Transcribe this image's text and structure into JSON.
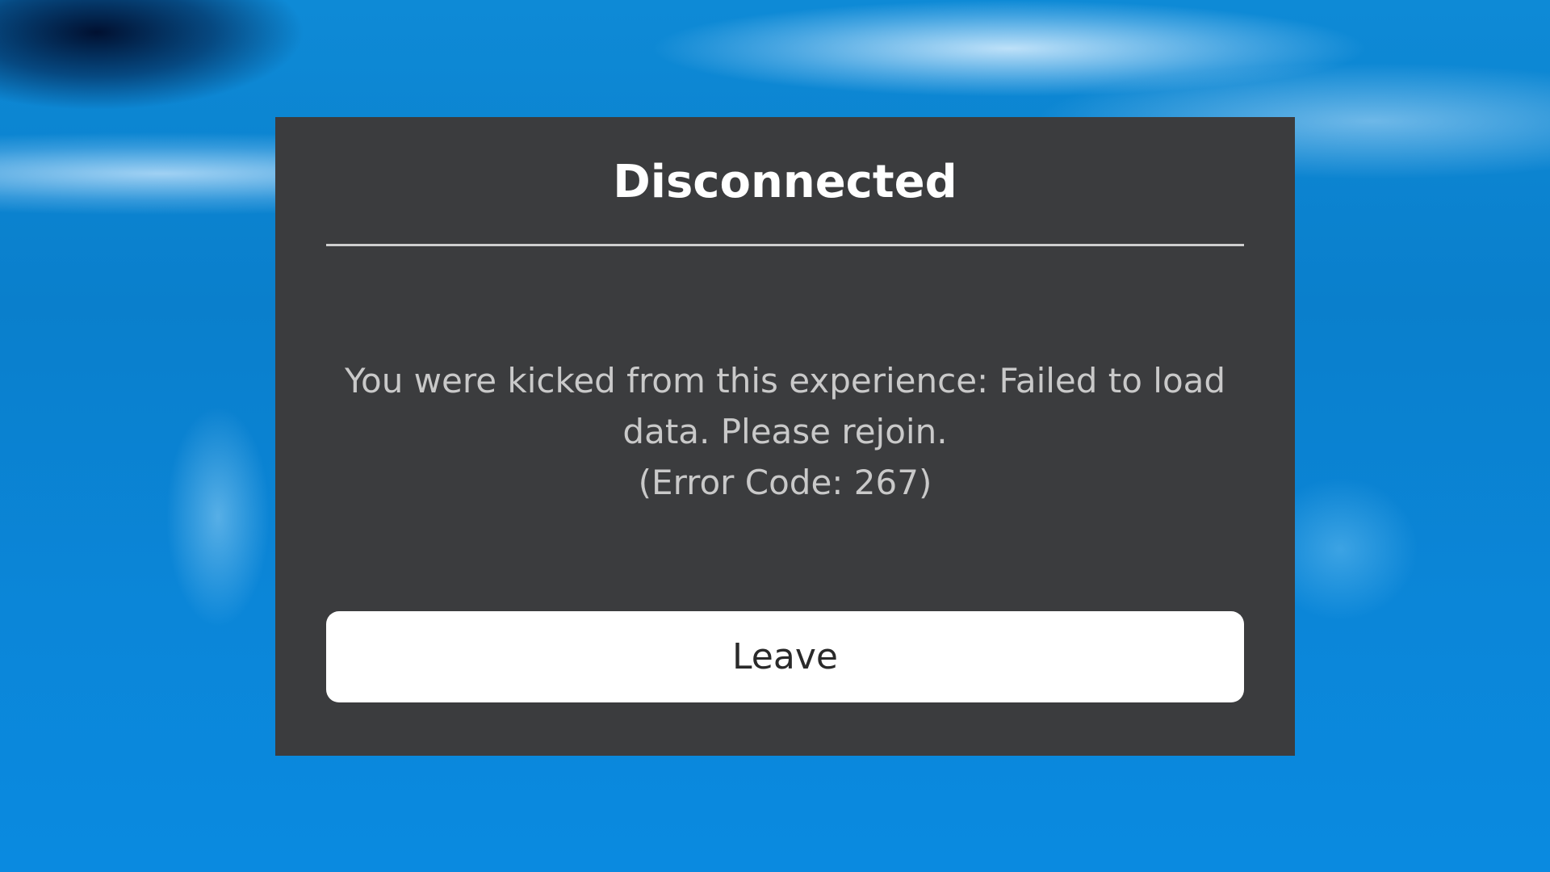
{
  "dialog": {
    "title": "Disconnected",
    "message": "You were kicked from this experience: Failed to load data. Please rejoin.",
    "error_code": "(Error Code: 267)",
    "leave_label": "Leave"
  },
  "colors": {
    "background": "#0a86d6",
    "dialog_background": "#3b3c3e",
    "title_text": "#ffffff",
    "message_text": "#c9c9c9",
    "divider": "#cfcfcf",
    "button_background": "#ffffff",
    "button_text": "#2a2a2a"
  }
}
